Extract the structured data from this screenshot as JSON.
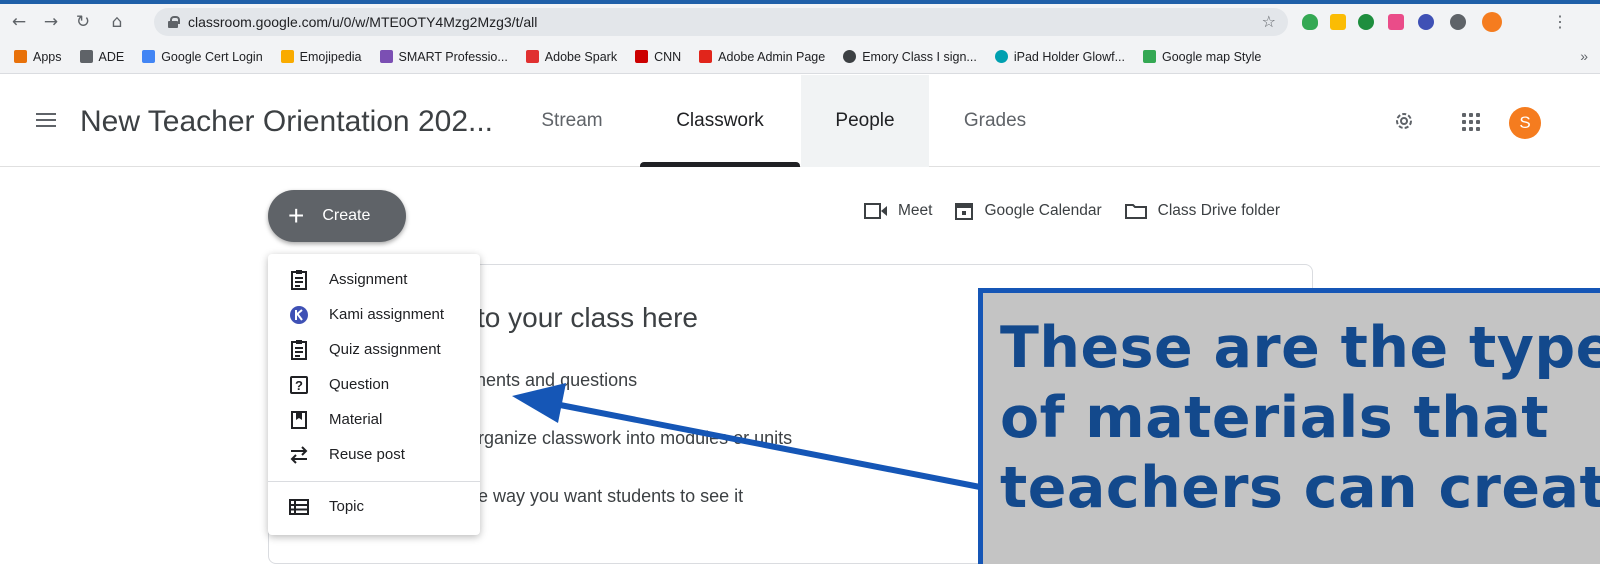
{
  "browser": {
    "url": "classroom.google.com/u/0/w/MTE0OTY4Mzg2Mzg3/t/all",
    "bookmarks": [
      {
        "label": "Apps",
        "color": "#e8710a"
      },
      {
        "label": "ADE",
        "color": "#5f6368"
      },
      {
        "label": "Google Cert Login",
        "color": "#4285f4"
      },
      {
        "label": "Emojipedia",
        "color": "#f9ab00"
      },
      {
        "label": "SMART Professio...",
        "color": "#7b4fb3"
      },
      {
        "label": "Adobe Spark",
        "color": "#e03030"
      },
      {
        "label": "CNN",
        "color": "#cc0000"
      },
      {
        "label": "Adobe Admin Page",
        "color": "#e1251b"
      },
      {
        "label": "Emory Class I sign...",
        "color": "#3c4043"
      },
      {
        "label": "iPad Holder Glowf...",
        "color": "#00a0b0"
      },
      {
        "label": "Google map Style",
        "color": "#34a853"
      }
    ],
    "more": "»"
  },
  "header": {
    "class_title": "New Teacher Orientation 202...",
    "tabs": [
      "Stream",
      "Classwork",
      "People",
      "Grades"
    ],
    "avatar_letter": "S",
    "avatar_color": "#f57c1f"
  },
  "main": {
    "create_label": "Create",
    "links": [
      "Meet",
      "Google Calendar",
      "Class Drive folder"
    ],
    "card_heading": "to your class here",
    "card_lines": [
      "nents and questions",
      "rganize classwork into modules or units",
      "e way you want students to see it"
    ]
  },
  "menu": {
    "items": [
      "Assignment",
      "Kami assignment",
      "Quiz assignment",
      "Question",
      "Material",
      "Reuse post"
    ],
    "topic": "Topic"
  },
  "callout": {
    "lines": [
      "These are the type",
      "of materials that",
      "teachers can creat"
    ],
    "border_color": "#1556b6",
    "text_color": "#13498c"
  }
}
